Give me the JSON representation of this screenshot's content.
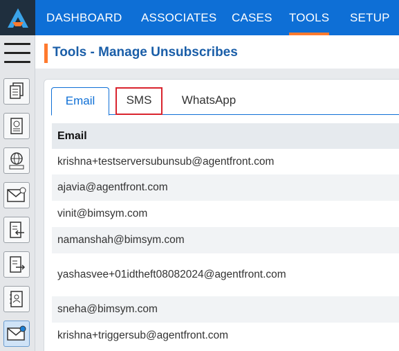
{
  "nav": {
    "items": [
      {
        "label": "DASHBOARD"
      },
      {
        "label": "ASSOCIATES"
      },
      {
        "label": "CASES"
      },
      {
        "label": "TOOLS"
      },
      {
        "label": "SETUP"
      }
    ],
    "active": "TOOLS",
    "accent_color": "#ff7a2e",
    "bar_color": "#0e6fd6"
  },
  "rail": {
    "icons": [
      "hamburger-menu-icon",
      "documents-icon",
      "report-icon",
      "web-icon",
      "email-icon",
      "import-icon",
      "export-icon",
      "contact-book-icon",
      "email-send-icon"
    ]
  },
  "page": {
    "title": "Tools - Manage Unsubscribes"
  },
  "tabs": [
    {
      "label": "Email"
    },
    {
      "label": "SMS"
    },
    {
      "label": "WhatsApp"
    }
  ],
  "table": {
    "header": "Email",
    "rows": [
      "krishna+testserversubunsub@agentfront.com",
      "ajavia@agentfront.com",
      "vinit@bimsym.com",
      "namanshah@bimsym.com",
      "yashasvee+01idtheft08082024@agentfront.com",
      "sneha@bimsym.com",
      "krishna+triggersub@agentfront.com"
    ]
  }
}
